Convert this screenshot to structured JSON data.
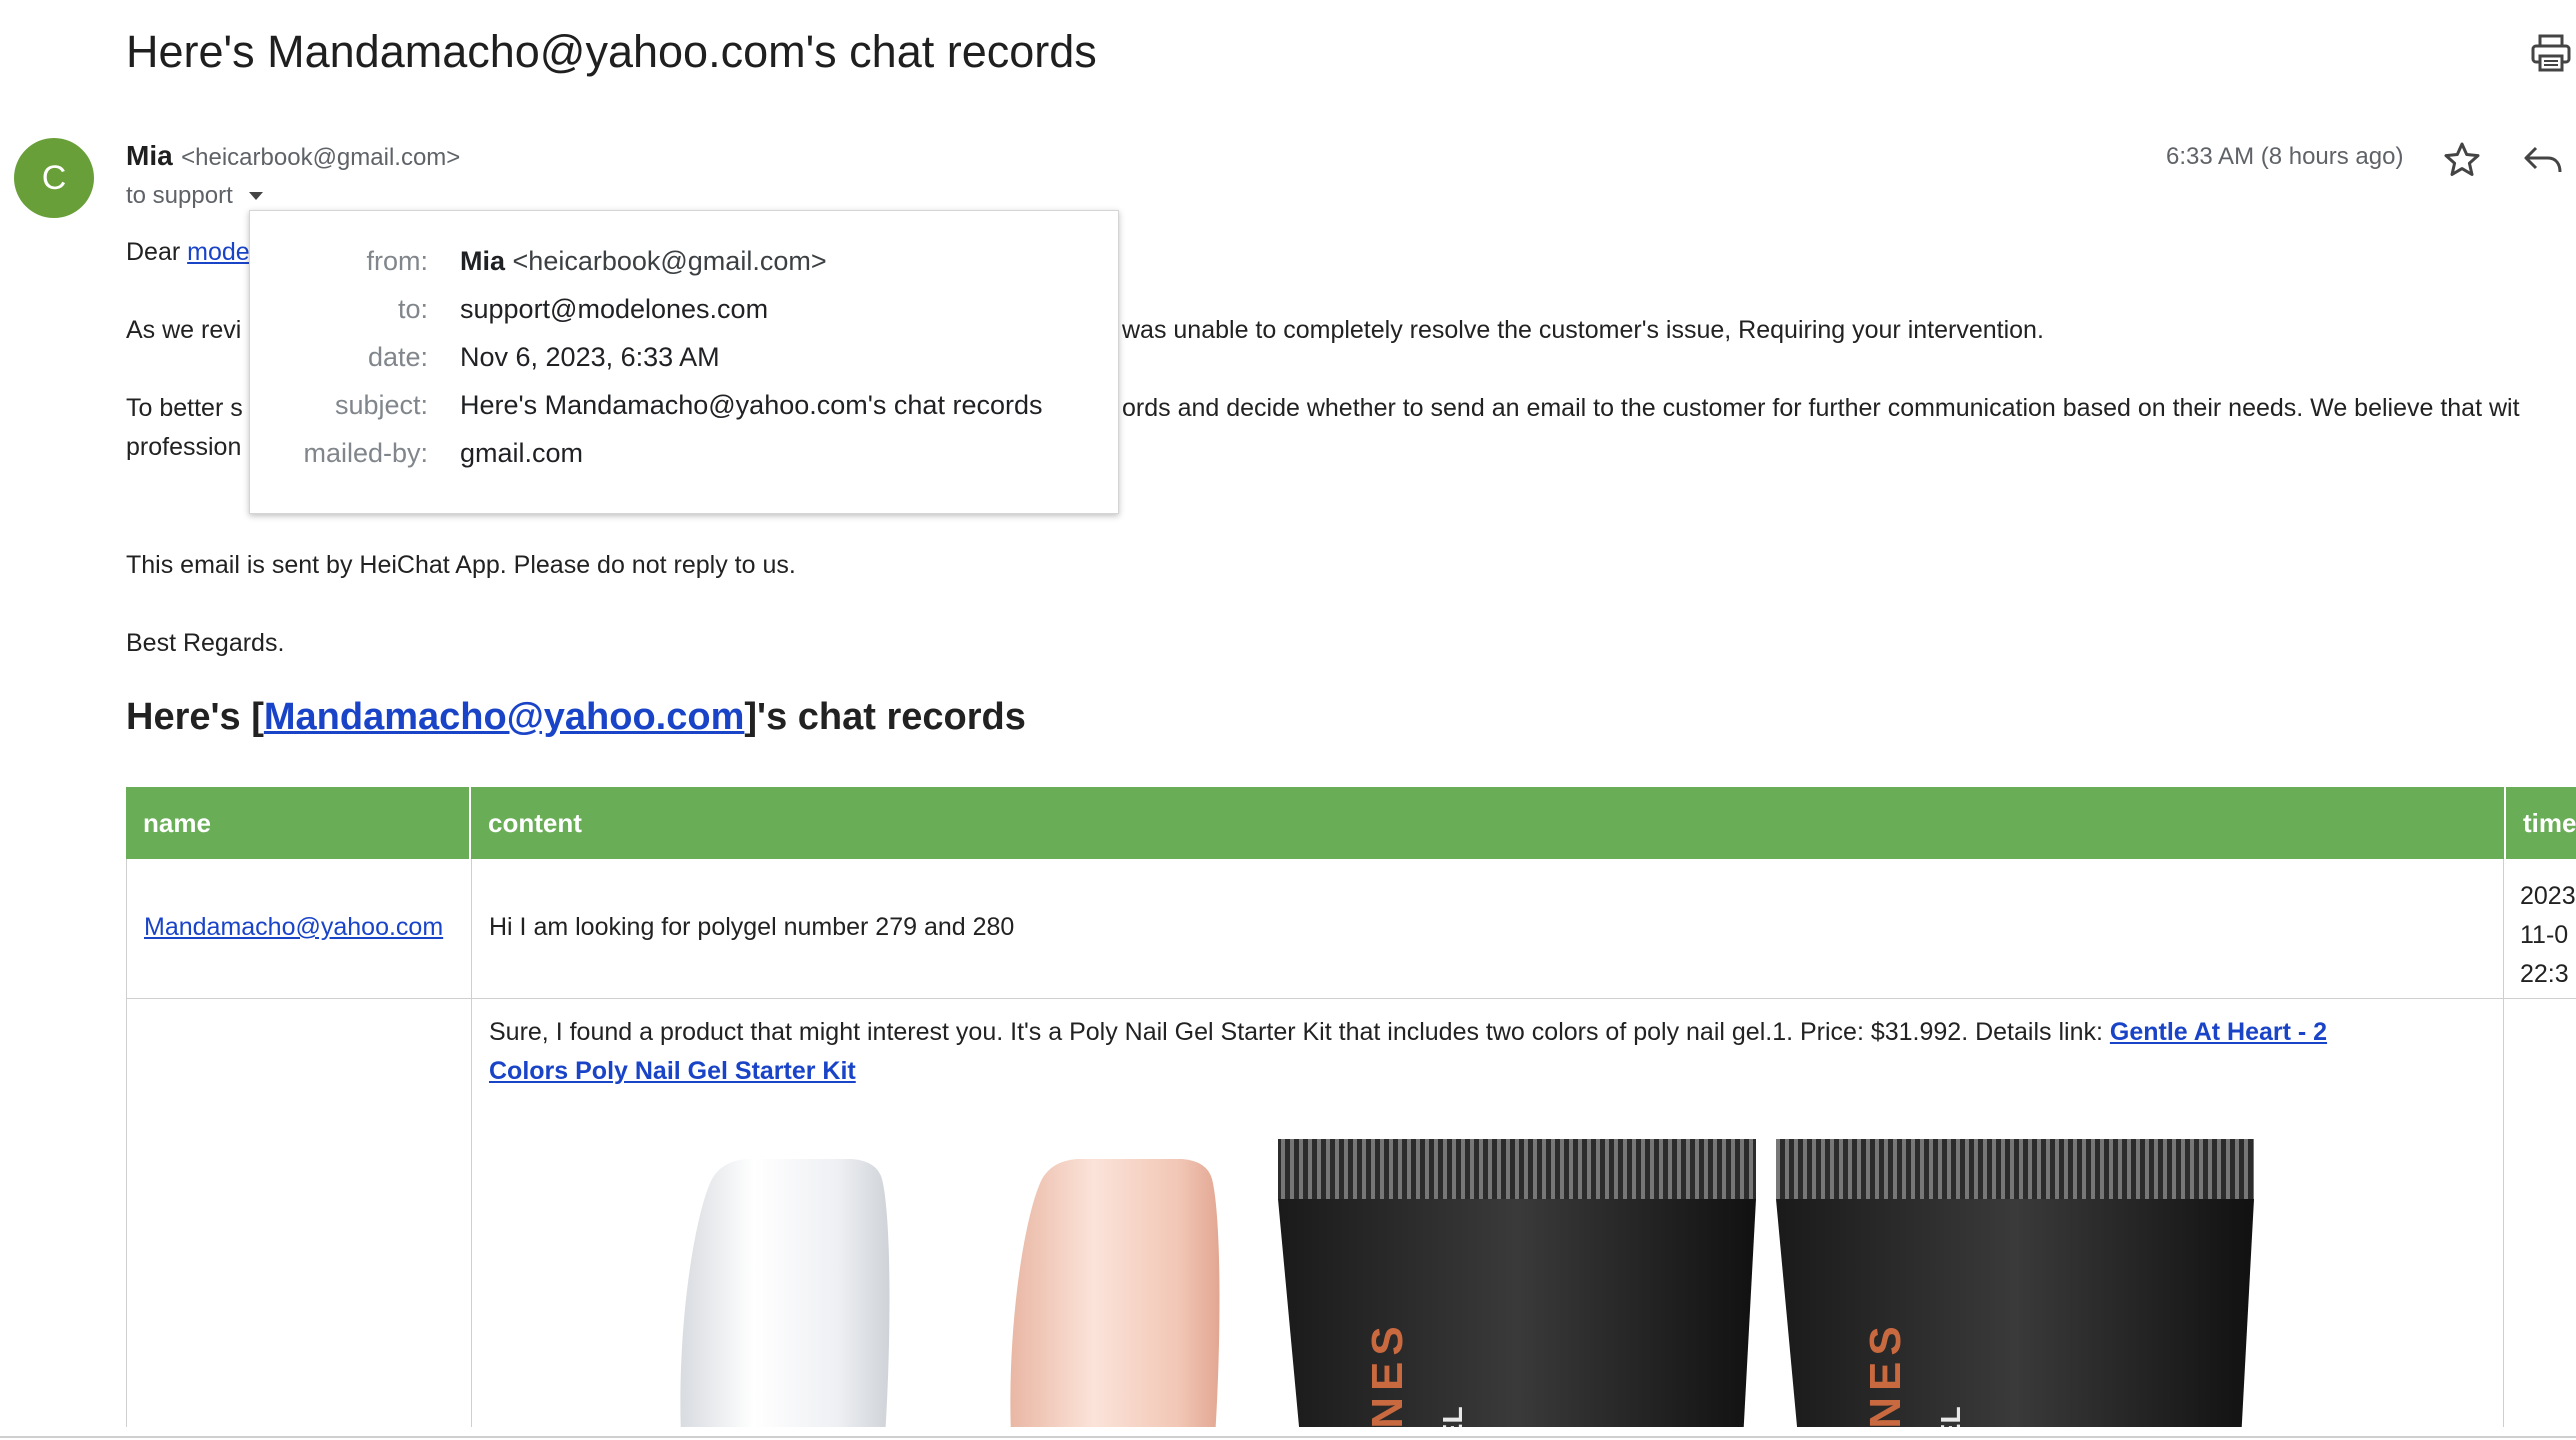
{
  "email": {
    "subject": "Here's Mandamacho@yahoo.com's chat records",
    "avatar_letter": "C",
    "sender_name": "Mia",
    "sender_email": "<heicarbook@gmail.com>",
    "to_line": "to support",
    "time": "6:33 AM (8 hours ago)"
  },
  "details_popup": {
    "from_label": "from:",
    "from_name": "Mia",
    "from_email": "<heicarbook@gmail.com>",
    "to_label": "to:",
    "to_value": "support@modelones.com",
    "date_label": "date:",
    "date_value": "Nov 6, 2023, 6:33 AM",
    "subject_label": "subject:",
    "subject_value": "Here's Mandamacho@yahoo.com's chat records",
    "mailed_by_label": "mailed-by:",
    "mailed_by_value": "gmail.com"
  },
  "body": {
    "greeting_prefix": "Dear ",
    "greeting_link": "mode",
    "para1_start": "As we revi",
    "para1_end": "was unable to completely resolve the customer's issue, Requiring your intervention.",
    "para2_start": "To better s",
    "para2_end": "ords and decide whether to send an email to the customer for further communication based on their needs. We believe that wit",
    "para2_line2": "profession",
    "notice": "This email is sent by HeiChat App. Please do not reply to us.",
    "signoff": "Best Regards."
  },
  "chat": {
    "heading_prefix": "Here's [",
    "heading_link": "Mandamacho@yahoo.com",
    "heading_suffix": "]'s chat records",
    "columns": [
      "name",
      "content",
      "time"
    ],
    "rows": [
      {
        "name": "Mandamacho@yahoo.com",
        "content": "Hi I am looking for polygel number 279 and 280",
        "time_lines": [
          "2023",
          "11-0",
          "22:3"
        ]
      },
      {
        "name": "",
        "content_text": "Sure, I found a product that might interest you. It's a Poly Nail Gel Starter Kit that includes two colors of poly nail gel.1. Price: $31.992. Details link: ",
        "content_link_line1": "Gentle At Heart - 2",
        "content_link_line2": "Colors Poly Nail Gel Starter Kit",
        "tube_label": "ONES",
        "tube_sub": "GEL"
      }
    ]
  },
  "colors": {
    "header_green": "#6aad57",
    "avatar_green": "#689f38",
    "link_blue": "#1a44c8"
  },
  "icons": [
    "print-icon",
    "star-icon",
    "reply-icon",
    "chevron-down-icon"
  ]
}
